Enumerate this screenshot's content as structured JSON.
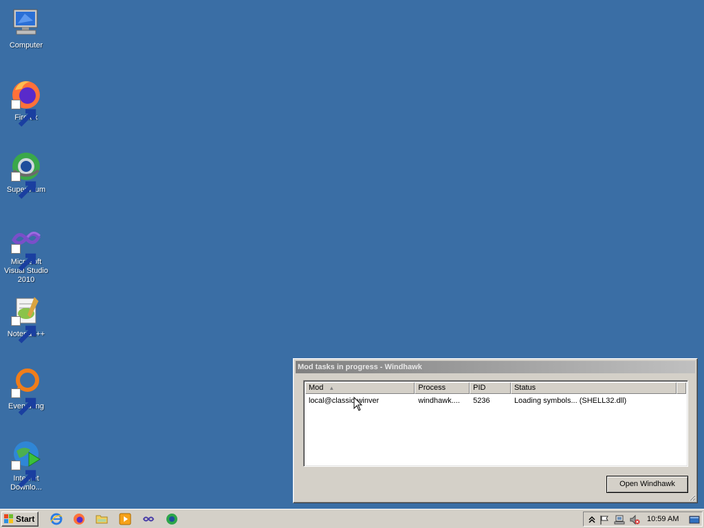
{
  "desktop": {
    "background": "#3a6ea5",
    "icons": [
      {
        "label": "Computer",
        "icon": "computer-icon"
      },
      {
        "label": "Firefox",
        "icon": "firefox-icon"
      },
      {
        "label": "Supermium",
        "icon": "supermium-icon"
      },
      {
        "label": "Microsoft Visual Studio 2010",
        "icon": "visual-studio-icon"
      },
      {
        "label": "Notepad++",
        "icon": "notepadpp-icon"
      },
      {
        "label": "Everything",
        "icon": "everything-icon"
      },
      {
        "label": "Internet Downlo...",
        "icon": "internet-download-manager-icon"
      }
    ]
  },
  "dialog": {
    "title": "Mod tasks in progress - Windhawk",
    "columns": [
      "Mod",
      "Process",
      "PID",
      "Status"
    ],
    "rows": [
      {
        "mod": "local@classic-winver",
        "process": "windhawk....",
        "pid": "5236",
        "status": "Loading symbols... (SHELL32.dll)"
      }
    ],
    "open_button": "Open Windhawk"
  },
  "taskbar": {
    "start_label": "Start",
    "quick_launch": [
      "internet-explorer-icon",
      "firefox-icon",
      "explorer-folder-icon",
      "media-player-icon",
      "visual-studio-icon",
      "supermium-icon"
    ],
    "clock": "10:59 AM"
  }
}
